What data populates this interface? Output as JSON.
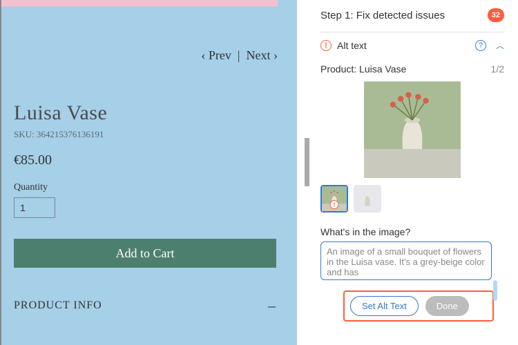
{
  "preview": {
    "nav_prev": "Prev",
    "nav_sep": "|",
    "nav_next": "Next",
    "title": "Luisa Vase",
    "sku": "SKU: 364215376136191",
    "price": "€85.00",
    "qty_label": "Quantity",
    "qty_value": "1",
    "add_label": "Add to Cart",
    "info_label": "PRODUCT INFO",
    "info_toggle": "–"
  },
  "panel": {
    "step": "Step 1: Fix detected issues",
    "count": "32",
    "section": "Alt text",
    "product_prefix": "Product:",
    "product_name": "Luisa Vase",
    "counter": "1/2",
    "prompt": "What's in the image?",
    "alt_text": "An image of a small bouquet of flowers in the Luisa vase. It's a grey-beige color and has",
    "set_label": "Set Alt Text",
    "done_label": "Done"
  }
}
